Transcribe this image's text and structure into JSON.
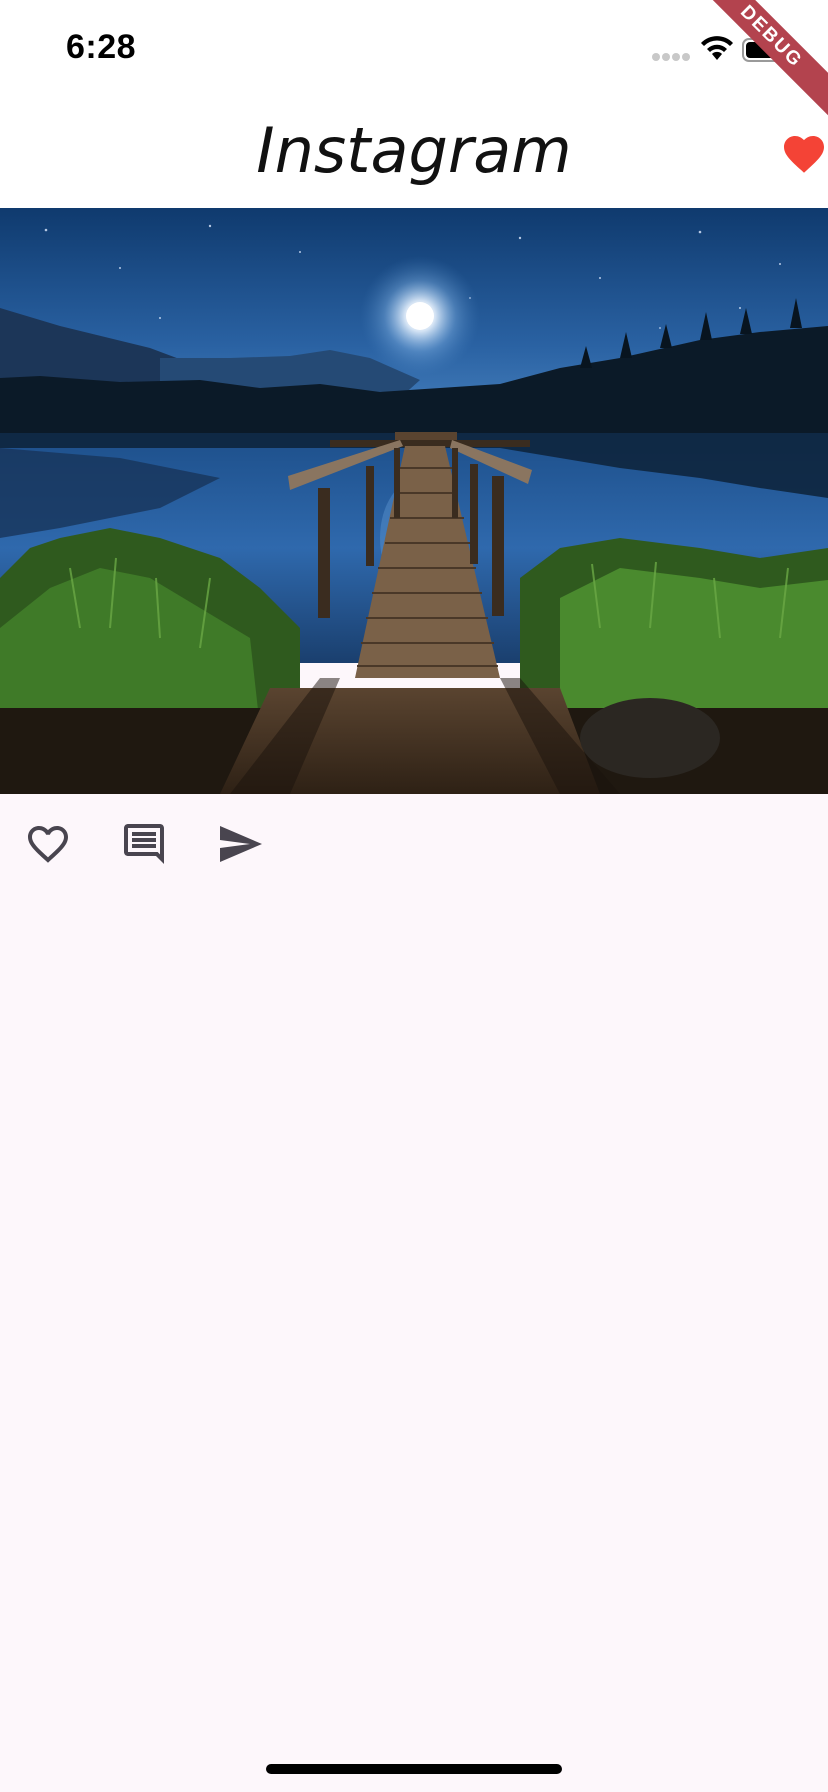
{
  "status_bar": {
    "time": "6:28",
    "icons": [
      "cellular-signal-icon",
      "wifi-icon",
      "battery-icon"
    ]
  },
  "debug_banner": {
    "label": "DEBUG",
    "color": "#b3434e"
  },
  "app_bar": {
    "title": "Instagram",
    "favorite_icon": "heart-filled-icon",
    "favorite_color": "#f44336"
  },
  "post": {
    "image_icon": "lake-pier-night-photo",
    "actions": [
      {
        "name": "like-button",
        "icon": "heart-outline-icon"
      },
      {
        "name": "comment-button",
        "icon": "comment-icon"
      },
      {
        "name": "share-button",
        "icon": "send-icon"
      }
    ]
  },
  "colors": {
    "background": "#fdf7fb",
    "icon": "#49454f"
  }
}
